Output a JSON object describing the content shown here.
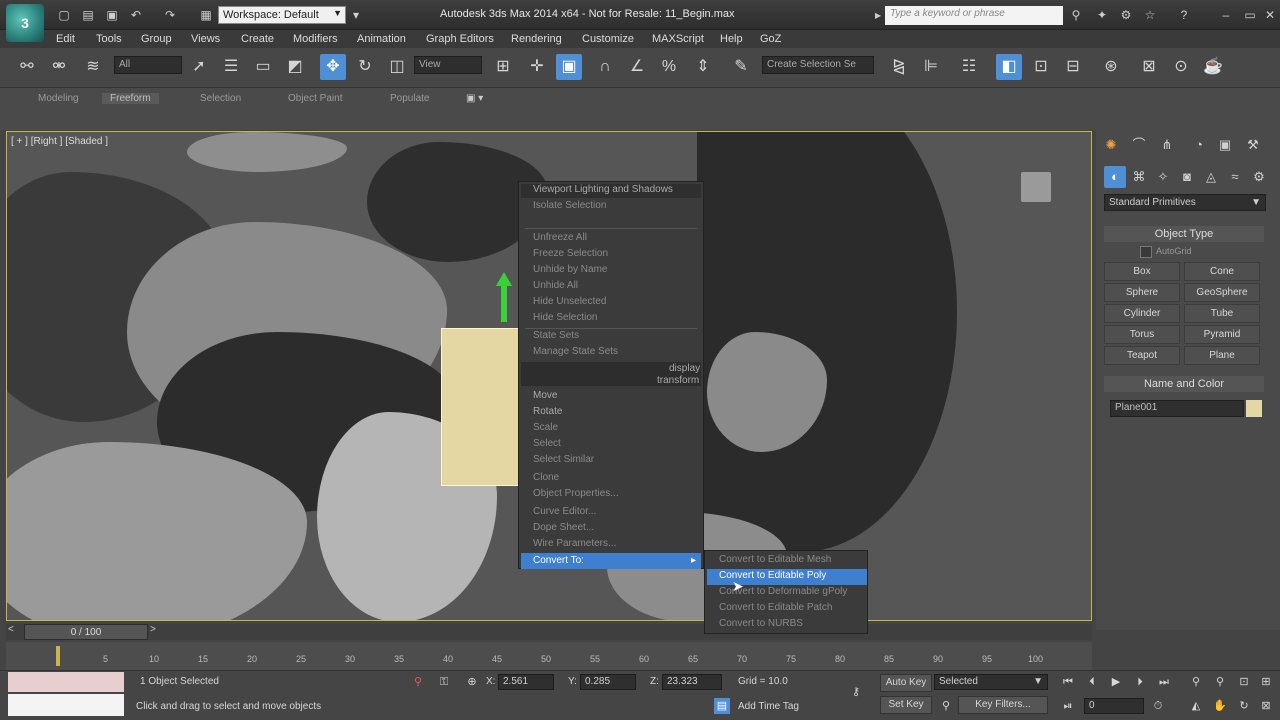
{
  "title_bar": {
    "logo": "3",
    "workspace": "Workspace: Default",
    "title": "Autodesk 3ds Max  2014 x64  - Not for Resale:  11_Begin.max",
    "search_placeholder": "Type a keyword or phrase"
  },
  "menu": [
    "Edit",
    "Tools",
    "Group",
    "Views",
    "Create",
    "Modifiers",
    "Animation",
    "Graph Editors",
    "Rendering",
    "Customize",
    "MAXScript",
    "Help",
    "GoZ"
  ],
  "toolbar": {
    "selection_filter": "All",
    "reference_coord": "View",
    "selection_set": "Create Selection Se"
  },
  "ribbon_tabs": [
    "Modeling",
    "Freeform",
    "Selection",
    "Object Paint",
    "Populate"
  ],
  "viewport": {
    "label": "[ + ] [Right ] [Shaded ]"
  },
  "quad_menu": {
    "items": [
      "Isolate Selection",
      "Unfreeze All",
      "Freeze Selection",
      "Unhide by Name",
      "Unhide All",
      "Hide Unselected",
      "Hide Selection",
      "State Sets",
      "Manage State Sets",
      "Move",
      "Rotate",
      "Scale",
      "Select",
      "Select Similar",
      "Clone",
      "Object Properties...",
      "Curve Editor...",
      "Dope Sheet...",
      "Wire Parameters...",
      "Convert To:"
    ],
    "header": "Viewport Lighting and Shadows",
    "display_label": "display",
    "transform_label": "transform"
  },
  "submenu": {
    "items": [
      "Convert to Editable Mesh",
      "Convert to Editable Poly",
      "Convert to Deformable gPoly",
      "Convert to Editable Patch",
      "Convert to NURBS"
    ]
  },
  "command_panel": {
    "dropdown": "Standard Primitives",
    "object_type_title": "Object Type",
    "autogrid": "AutoGrid",
    "primitives": [
      "Box",
      "Cone",
      "Sphere",
      "GeoSphere",
      "Cylinder",
      "Tube",
      "Torus",
      "Pyramid",
      "Teapot",
      "Plane"
    ],
    "name_color_title": "Name and Color",
    "object_name": "Plane001",
    "object_color": "#e4d7a3"
  },
  "timeline": {
    "frame": "0 / 100",
    "ticks": [
      "5",
      "10",
      "15",
      "20",
      "25",
      "30",
      "35",
      "40",
      "45",
      "50",
      "55",
      "60",
      "65",
      "70",
      "75",
      "80",
      "85",
      "90",
      "95",
      "100"
    ]
  },
  "status_bar": {
    "selection": "1 Object Selected",
    "prompt": "Click and drag to select and move objects",
    "x_label": "X:",
    "x_value": "2.561",
    "y_label": "Y:",
    "y_value": "0.285",
    "z_label": "Z:",
    "z_value": "23.323",
    "grid": "Grid = 10.0",
    "auto_key": "Auto Key",
    "selected": "Selected",
    "set_key": "Set Key",
    "key_filters": "Key Filters...",
    "add_time_tag": "Add Time Tag",
    "frame_field": "0"
  },
  "colors": {
    "accent": "#4f8fd6",
    "highlight": "#3f7fd0",
    "viewport_border": "#c9b54a"
  }
}
